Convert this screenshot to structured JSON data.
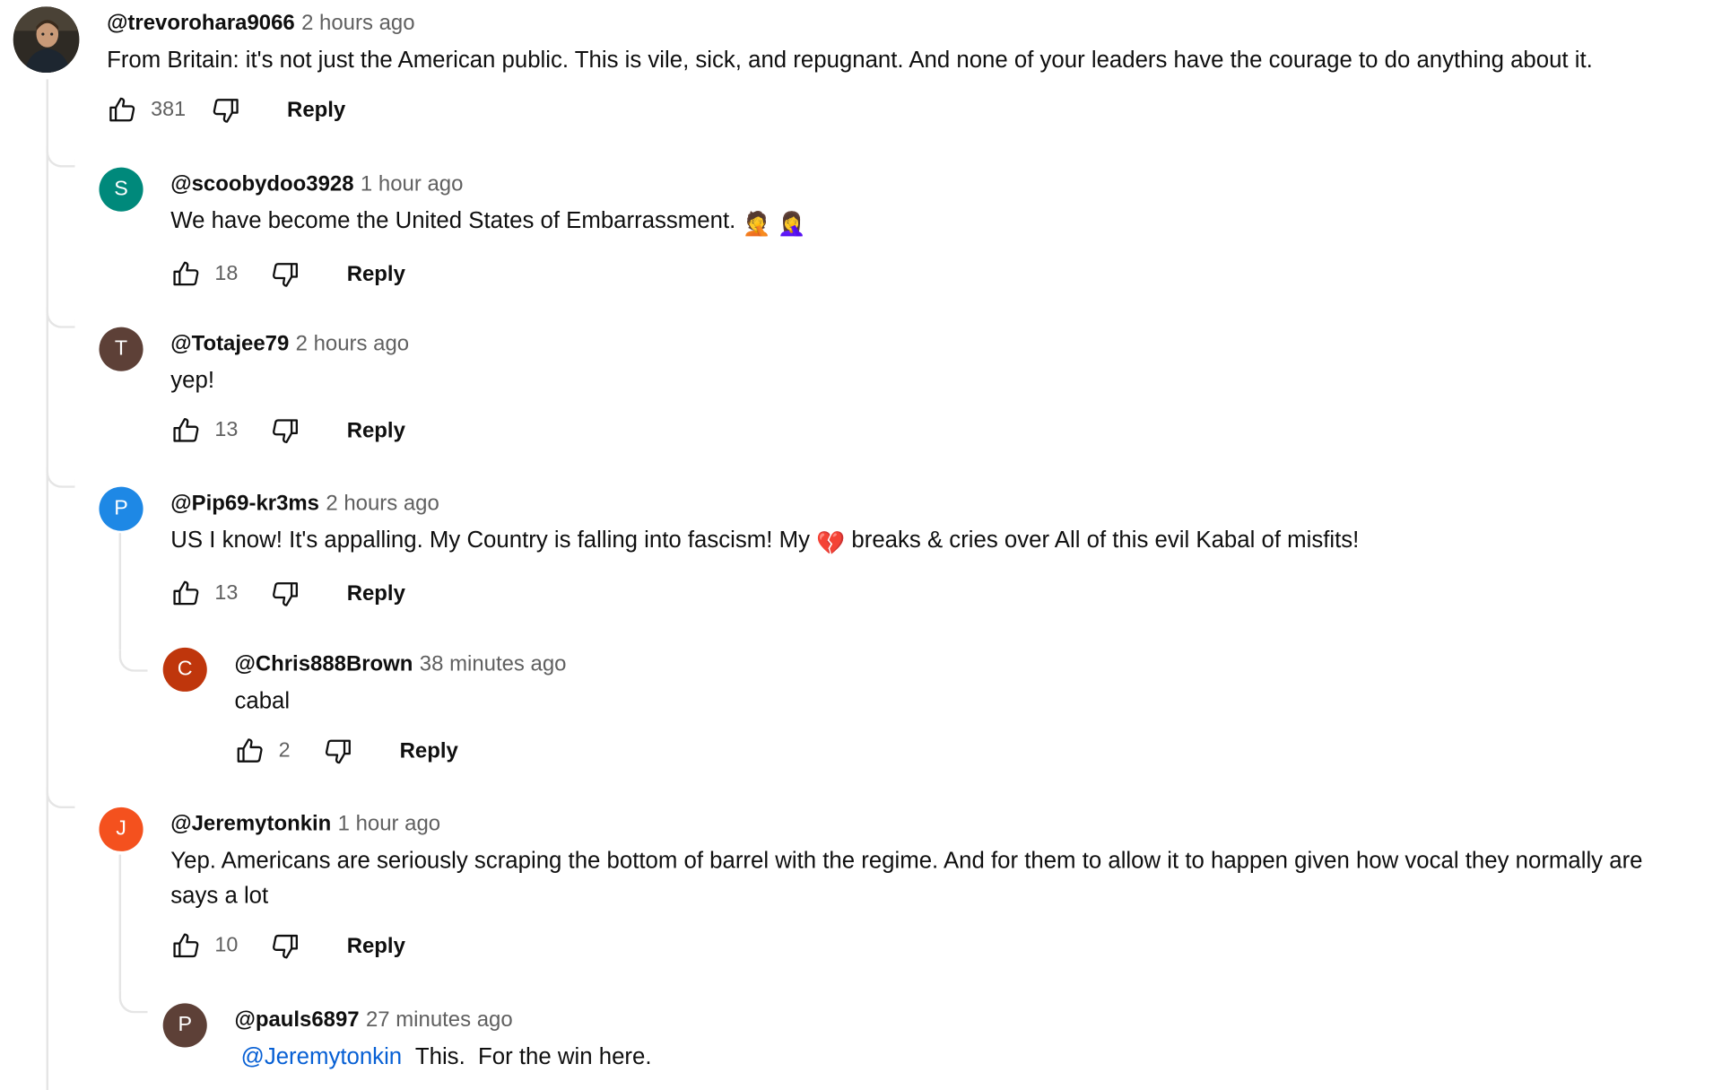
{
  "comments": {
    "main": {
      "handle": "@trevorohara9066",
      "time": "2 hours ago",
      "text": "From Britain: it's not just the American public. This is vile, sick, and repugnant. And none of your leaders have the courage to do anything about it.",
      "likes": "381",
      "reply_label": "Reply"
    },
    "r1": {
      "avatar_letter": "S",
      "avatar_color": "#00897b",
      "handle": "@scoobydoo3928",
      "time": "1 hour ago",
      "text": "We have become the United States of Embarrassment.",
      "emojis": "🤦 🤦‍♀️",
      "likes": "18",
      "reply_label": "Reply"
    },
    "r2": {
      "avatar_letter": "T",
      "avatar_color": "#5d4037",
      "handle": "@Totajee79",
      "time": "2 hours ago",
      "text": "yep!",
      "likes": "13",
      "reply_label": "Reply"
    },
    "r3": {
      "avatar_letter": "P",
      "avatar_color": "#1e88e5",
      "handle": "@Pip69-kr3ms",
      "time": "2 hours ago",
      "text_a": "US I know! It's appalling. My Country is falling into fascism! My",
      "emoji": "💔",
      "text_b": "breaks & cries over All of this evil Kabal of misfits!",
      "likes": "13",
      "reply_label": "Reply"
    },
    "r4": {
      "avatar_letter": "C",
      "avatar_color": "#bf360c",
      "handle": "@Chris888Brown",
      "time": "38 minutes ago",
      "text": "cabal",
      "likes": "2",
      "reply_label": "Reply"
    },
    "r5": {
      "avatar_letter": "J",
      "avatar_color": "#f4511e",
      "handle": "@Jeremytonkin",
      "time": "1 hour ago",
      "text": "Yep. Americans are seriously scraping the bottom of barrel with the regime. And for them to allow it to happen given how vocal they normally are says a lot",
      "likes": "10",
      "reply_label": "Reply"
    },
    "r6": {
      "avatar_letter": "P",
      "avatar_color": "#5d4037",
      "handle": "@pauls6897",
      "time": "27 minutes ago",
      "mention": "@Jeremytonkin",
      "text": "This.  For the win here."
    }
  }
}
